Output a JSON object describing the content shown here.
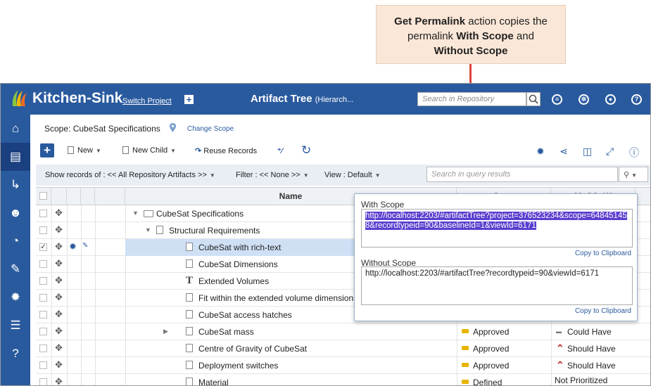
{
  "callout": {
    "text1_bold": "Get Permalink",
    "text1_rest": " action copies the",
    "text2_pre": "permalink ",
    "text2_bold": "With Scope",
    "text2_post": " and",
    "text3_bold": "Without Scope"
  },
  "topbar": {
    "app_title": "Kitchen-Sink",
    "switch_project": "Switch Project",
    "page_title": "Artifact Tree",
    "page_title_sub": "(Hierarch...",
    "search_placeholder": "Search in Repository"
  },
  "sidebar": {
    "items": [
      "home-icon",
      "database-icon",
      "trace-icon",
      "users-icon",
      "chart-icon",
      "tools-icon",
      "gear-icon",
      "menu-icon",
      "help-icon"
    ]
  },
  "scope": {
    "label": "Scope: CubeSat Specifications",
    "change_scope": "Change Scope"
  },
  "toolbar": {
    "new_label": "New",
    "new_child_label": "New Child",
    "reuse_label": "Reuse Records"
  },
  "filterbar": {
    "show_records": "Show records of : << All Repository Artifacts >>",
    "filter": "Filter : << None >>",
    "view": "View : Default",
    "query_placeholder": "Search in query results"
  },
  "grid": {
    "headers": {
      "name": "Name",
      "state": "State",
      "moscow": "MoSCoW"
    },
    "rows": [
      {
        "name": "CubeSat Specifications",
        "indent": 0,
        "icon": "folder",
        "state": "",
        "moscow": ""
      },
      {
        "name": "Structural Requirements",
        "indent": 1,
        "icon": "doc",
        "state": "",
        "moscow": ""
      },
      {
        "name": "CubeSat with rich-text",
        "indent": 2,
        "icon": "doc",
        "state": "",
        "moscow": "",
        "selected": true
      },
      {
        "name": "CubeSat Dimensions",
        "indent": 2,
        "icon": "doc",
        "state": "",
        "moscow": ""
      },
      {
        "name": "Extended Volumes",
        "indent": 2,
        "icon": "text",
        "state": "",
        "moscow": ""
      },
      {
        "name": "Fit within the extended volume dimensions",
        "indent": 2,
        "icon": "doc",
        "state": "",
        "moscow": ""
      },
      {
        "name": "CubeSat access hatches",
        "indent": 2,
        "icon": "doc",
        "state": "",
        "moscow": ""
      },
      {
        "name": "CubeSat mass",
        "indent": 2,
        "icon": "doc",
        "state": "Approved",
        "moscow": "Could Have"
      },
      {
        "name": "Centre of Gravity of CubeSat",
        "indent": 2,
        "icon": "doc",
        "state": "Approved",
        "moscow": "Should Have"
      },
      {
        "name": "Deployment switches",
        "indent": 2,
        "icon": "doc",
        "state": "Approved",
        "moscow": "Should Have"
      },
      {
        "name": "Material",
        "indent": 2,
        "icon": "doc",
        "state": "Defined",
        "moscow": "Not Prioritized"
      }
    ]
  },
  "permalink": {
    "with_scope_label": "With Scope",
    "with_scope_url": "http://localhost:2203/#artifactTree?project=376523234&scope=648451458&recordtypeid=90&baselineId=1&viewId=6171",
    "without_scope_label": "Without Scope",
    "without_scope_url": "http://localhost:2203/#artifactTree?recordtypeid=90&viewId=6171",
    "copy_label": "Copy to Clipboard"
  },
  "colors": {
    "brand": "#2a5a9e",
    "callout_bg": "#fae7d7",
    "arrow": "#e0443c",
    "highlight": "#5b3ecf",
    "approved": "#e6b400"
  }
}
